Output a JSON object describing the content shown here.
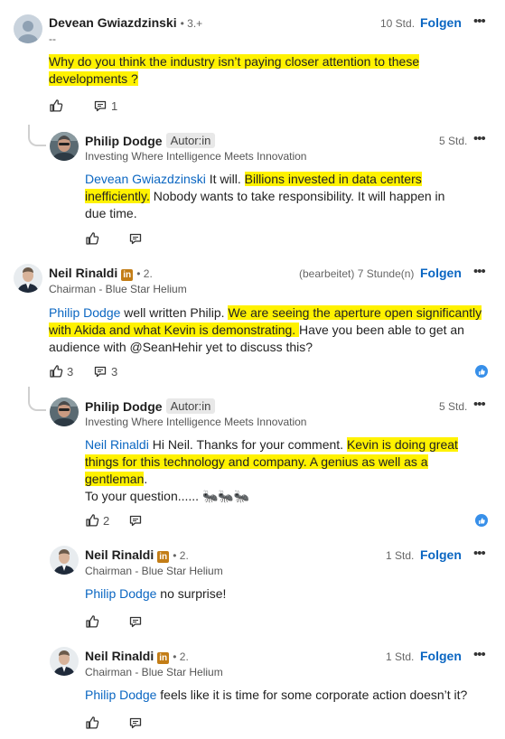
{
  "comments": [
    {
      "author": "Devean Gwiazdzinski",
      "degree": "• 3.+",
      "subtitle": "--",
      "time": "10 Std.",
      "follow": "Folgen",
      "text_hl": "Why do you think the industry isn’t paying closer attention to these developments ?",
      "comment_count": "1"
    },
    {
      "author": "Philip Dodge",
      "badge": "Autor:in",
      "subtitle": "Investing Where Intelligence Meets Innovation",
      "time": "5 Std.",
      "mention": "Devean Gwiazdzinski",
      "t1": " It will. ",
      "t2_hl": "Billions invested in data centers inefficiently.",
      "t3": " Nobody wants to take responsibility. It will happen in due time."
    },
    {
      "author": "Neil Rinaldi",
      "in_badge": "in",
      "degree": "• 2.",
      "subtitle": "Chairman - Blue Star Helium",
      "time": "(bearbeitet) 7 Stunde(n)",
      "follow": "Folgen",
      "mention": "Philip Dodge",
      "t1": " well written Philip. ",
      "t2_hl": " We are seeing the aperture open significantly with Akida and what Kevin is demonstrating. ",
      "t3": " Have you been able to get an audience with @SeanHehir yet to discuss this?",
      "like_count": "3",
      "comment_count": "3"
    },
    {
      "author": "Philip Dodge",
      "badge": "Autor:in",
      "subtitle": "Investing Where Intelligence Meets Innovation",
      "time": "5 Std.",
      "mention": "Neil Rinaldi",
      "t1": " Hi Neil. Thanks for your comment. ",
      "t2_hl": "Kevin is doing great things for this technology and company. A genius as well as a gentleman",
      "t3": ".",
      "line2": "To your question...... 🐜🐜🐜",
      "like_count": "2"
    },
    {
      "author": "Neil Rinaldi",
      "in_badge": "in",
      "degree": "• 2.",
      "subtitle": "Chairman - Blue Star Helium",
      "time": "1 Std.",
      "follow": "Folgen",
      "mention": "Philip Dodge",
      "t1": " no surprise!"
    },
    {
      "author": "Neil Rinaldi",
      "in_badge": "in",
      "degree": "• 2.",
      "subtitle": "Chairman - Blue Star Helium",
      "time": "1 Std.",
      "follow": "Folgen",
      "mention": "Philip Dodge",
      "t1": " feels like it is time for some corporate action doesn’t it?"
    }
  ],
  "icons": {
    "like": "thumbs-up-icon",
    "reply": "comment-icon",
    "more": "more-icon",
    "reaction": "like-reaction-icon"
  },
  "colors": {
    "link": "#0a66c2",
    "highlight": "#fff200",
    "in_badge": "#c37d16"
  }
}
